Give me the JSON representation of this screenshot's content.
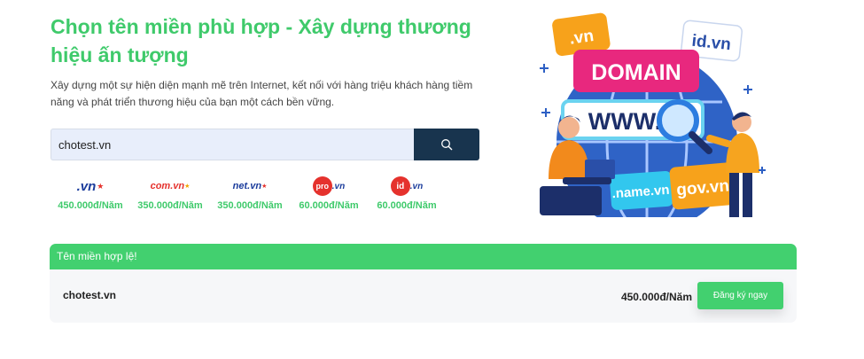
{
  "hero": {
    "title": "Chọn tên miền phù hợp - Xây dựng thương hiệu ấn tượng",
    "description": "Xây dựng một sự hiện diện mạnh mẽ trên Internet, kết nối với hàng triệu khách hàng tiềm năng và phát triển thương hiệu của bạn một cách bền vững."
  },
  "search": {
    "value": "chotest.vn",
    "button_icon": "search-icon"
  },
  "tlds": [
    {
      "name": ".vn",
      "price": "450.000đ/Năm"
    },
    {
      "name": "com.vn",
      "price": "350.000đ/Năm"
    },
    {
      "name": "net.vn",
      "price": "350.000đ/Năm"
    },
    {
      "name": "pro.vn",
      "price": "60.000đ/Năm"
    },
    {
      "name": "id.vn",
      "price": "60.000đ/Năm"
    }
  ],
  "result": {
    "status": "Tên miền hợp lệ!",
    "domain": "chotest.vn",
    "price": "450.000đ/Năm",
    "register_label": "Đăng ký ngay"
  },
  "illustration": {
    "tags": [
      ".vn",
      "id.vn",
      "DOMAIN",
      "WWW.",
      ".name.vn",
      "gov.vn"
    ]
  },
  "colors": {
    "accent_green": "#3fca6b",
    "navy": "#18344e"
  }
}
